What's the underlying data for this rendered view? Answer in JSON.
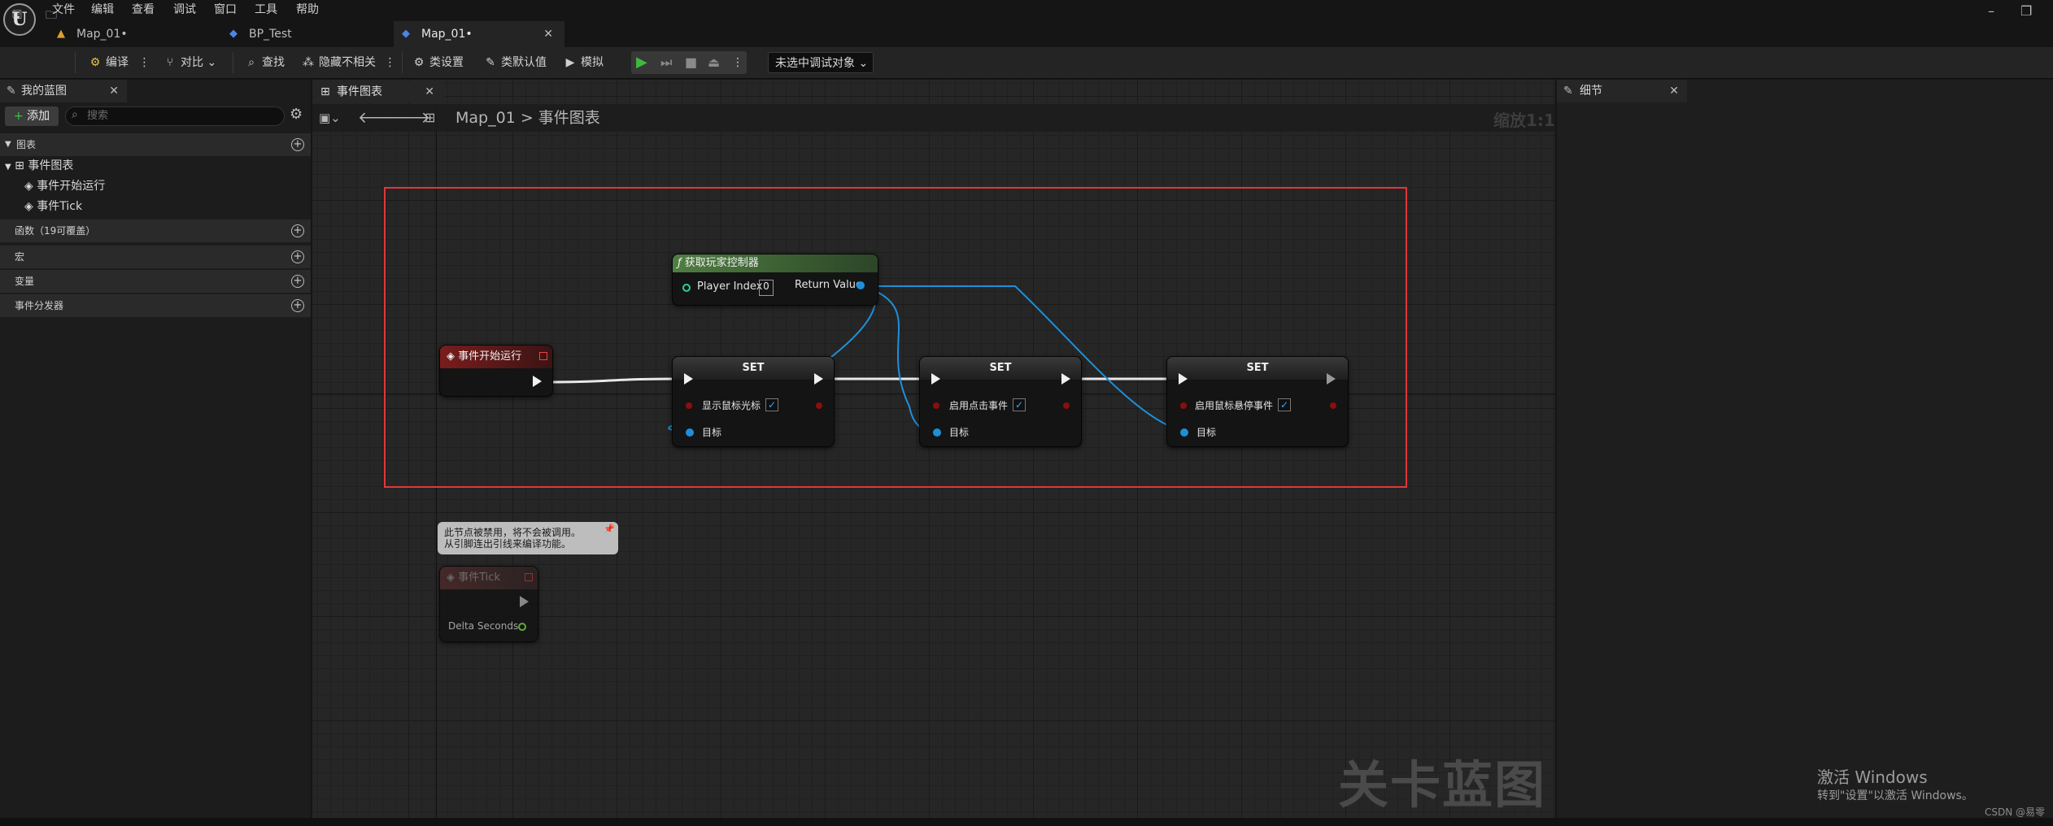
{
  "menu": {
    "logo": "U",
    "items": [
      "文件",
      "编辑",
      "查看",
      "调试",
      "窗口",
      "工具",
      "帮助"
    ]
  },
  "doc_tabs": [
    {
      "label": "Map_01•",
      "icon": "level-icon"
    },
    {
      "label": "BP_Test",
      "icon": "blueprint-icon"
    },
    {
      "label": "Map_01•",
      "icon": "blueprint-icon",
      "active": true
    }
  ],
  "window": {
    "minimize": "–",
    "restore": "❐"
  },
  "toolbar": {
    "compile": "编译",
    "diff": "对比",
    "find": "查找",
    "hide_unrelated": "隐藏不相关",
    "class_settings": "类设置",
    "class_defaults": "类默认值",
    "simulate": "模拟",
    "debug_object": "未选中调试对象"
  },
  "left_panel": {
    "tab_title": "我的蓝图",
    "add_label": "添加",
    "search_placeholder": "搜索",
    "section_graphs": "图表",
    "graph_name": "事件图表",
    "events": [
      "事件开始运行",
      "事件Tick"
    ],
    "section_functions": "函数（19可覆盖）",
    "section_macros": "宏",
    "section_variables": "变量",
    "section_dispatchers": "事件分发器"
  },
  "graph": {
    "tab_title": "事件图表",
    "breadcrumb_root": "Map_01",
    "breadcrumb_sep": ">",
    "breadcrumb_current": "事件图表",
    "zoom": "缩放1:1",
    "watermark": "关卡蓝图",
    "nodes": {
      "begin_play": "事件开始运行",
      "get_pc_title": "获取玩家控制器",
      "player_index_label": "Player Index",
      "player_index_value": "0",
      "return_value": "Return Value",
      "set1_title": "SET",
      "set1_var": "显示鼠标光标",
      "set2_title": "SET",
      "set2_var": "启用点击事件",
      "set3_title": "SET",
      "set3_var": "启用鼠标悬停事件",
      "target": "目标",
      "tick_title": "事件Tick",
      "delta_seconds": "Delta Seconds"
    },
    "comment_line1": "此节点被禁用，将不会被调用。",
    "comment_line2": "从引脚连出引线来编译功能。"
  },
  "right_panel": {
    "tab_title": "细节"
  },
  "overlay": {
    "activate_title": "激活 Windows",
    "activate_sub": "转到\"设置\"以激活 Windows。",
    "credit": "CSDN @易零"
  },
  "colors": {
    "accent_select": "#e0373a",
    "wire_blue": "#1f8fd8",
    "event_red": "#7a1c1c",
    "func_green": "#4f7e42"
  }
}
